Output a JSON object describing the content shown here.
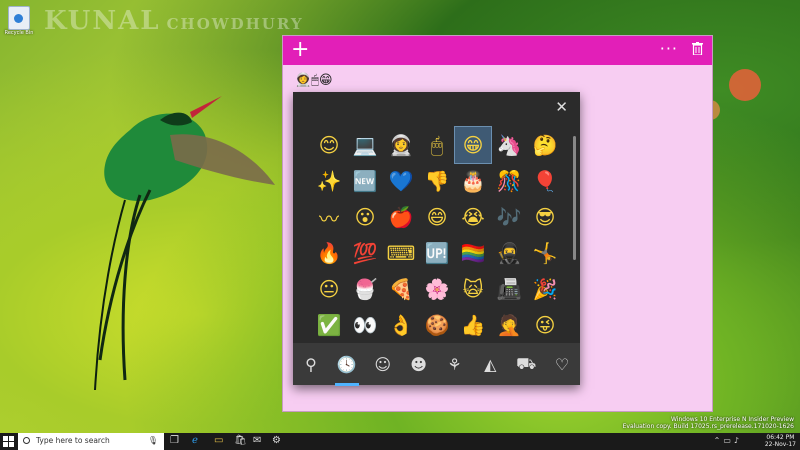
{
  "desktop": {
    "icon_label": "Recycle Bin",
    "watermark": "KUNAL",
    "watermark_sub": "CHOWDHURY"
  },
  "note": {
    "add_label": "+",
    "more_label": "···",
    "text": "👩‍🚀🖱😁",
    "accent": "#e21fb8",
    "bg": "#f7cdf2"
  },
  "emoji_panel": {
    "close_label": "✕",
    "grid": [
      "😊",
      "💻",
      "👩‍🚀",
      "🖱",
      "😁",
      "🦄",
      "🤔",
      "✨",
      "🆕",
      "💙",
      "👎",
      "🎂",
      "🎊",
      "🎈",
      "〰",
      "😮",
      "🍎",
      "😄",
      "😭",
      "🎶",
      "😎",
      "🔥",
      "💯",
      "⌨",
      "🆙",
      "🏳️‍🌈",
      "🥷",
      "🤸",
      "😐",
      "🍧",
      "🍕",
      "🌸",
      "🙀",
      "📠",
      "🎉",
      "✅",
      "👀",
      "👌",
      "🍪",
      "👍",
      "🤦",
      "😜"
    ],
    "selected_index": 4,
    "tabs": [
      {
        "name": "search",
        "glyph": "⚲"
      },
      {
        "name": "recent",
        "glyph": "🕓"
      },
      {
        "name": "smileys",
        "glyph": "☺"
      },
      {
        "name": "people",
        "glyph": "☻"
      },
      {
        "name": "celebration",
        "glyph": "⚘"
      },
      {
        "name": "food",
        "glyph": "◭"
      },
      {
        "name": "travel",
        "glyph": "⛟"
      },
      {
        "name": "symbols",
        "glyph": "♡"
      }
    ],
    "active_tab_index": 1,
    "accent": "#4fb3ff"
  },
  "taskbar": {
    "search_placeholder": "Type here to search",
    "time": "06:42 PM",
    "date": "22-Nov-17"
  },
  "eval_notice": {
    "line1": "Windows 10 Enterprise N Insider Preview",
    "line2": "Evaluation copy. Build 17025.rs_prerelease.171020-1626"
  }
}
